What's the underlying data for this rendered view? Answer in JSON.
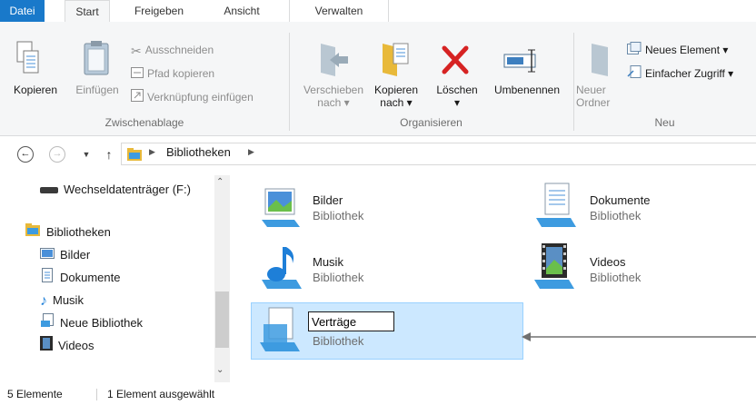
{
  "ribbon": {
    "tabs": [
      {
        "label": "Datei"
      },
      {
        "label": "Start"
      },
      {
        "label": "Freigeben"
      },
      {
        "label": "Ansicht"
      },
      {
        "label": "Verwalten"
      }
    ],
    "clipboard": {
      "copy": "Kopieren",
      "paste": "Einfügen",
      "cut": "Ausschneiden",
      "copy_path": "Pfad kopieren",
      "paste_shortcut": "Verknüpfung einfügen",
      "group_label": "Zwischenablage"
    },
    "organize": {
      "move_line1": "Verschieben",
      "move_line2": "nach",
      "copyto_line1": "Kopieren",
      "copyto_line2": "nach",
      "delete": "Löschen",
      "rename": "Umbenennen",
      "group_label": "Organisieren"
    },
    "new": {
      "folder_line1": "Neuer",
      "folder_line2": "Ordner",
      "new_item": "Neues Element",
      "easy_access": "Einfacher Zugriff",
      "group_label": "Neu"
    }
  },
  "address": {
    "path": "Bibliotheken"
  },
  "nav": {
    "drive": "Wechseldatenträger (F:)",
    "libraries": "Bibliotheken",
    "items": [
      {
        "label": "Bilder"
      },
      {
        "label": "Dokumente"
      },
      {
        "label": "Musik"
      },
      {
        "label": "Neue Bibliothek"
      },
      {
        "label": "Videos"
      }
    ]
  },
  "content": {
    "libraries": [
      {
        "name": "Bilder",
        "type": "Bibliothek"
      },
      {
        "name": "Dokumente",
        "type": "Bibliothek"
      },
      {
        "name": "Musik",
        "type": "Bibliothek"
      },
      {
        "name": "Videos",
        "type": "Bibliothek"
      },
      {
        "name": "Verträge",
        "type": "Bibliothek"
      }
    ]
  },
  "status": {
    "count": "5 Elemente",
    "selected": "1 Element ausgewählt"
  },
  "colors": {
    "accent": "#1979ca",
    "selection": "#cce8ff",
    "selection_border": "#99d1ff"
  }
}
